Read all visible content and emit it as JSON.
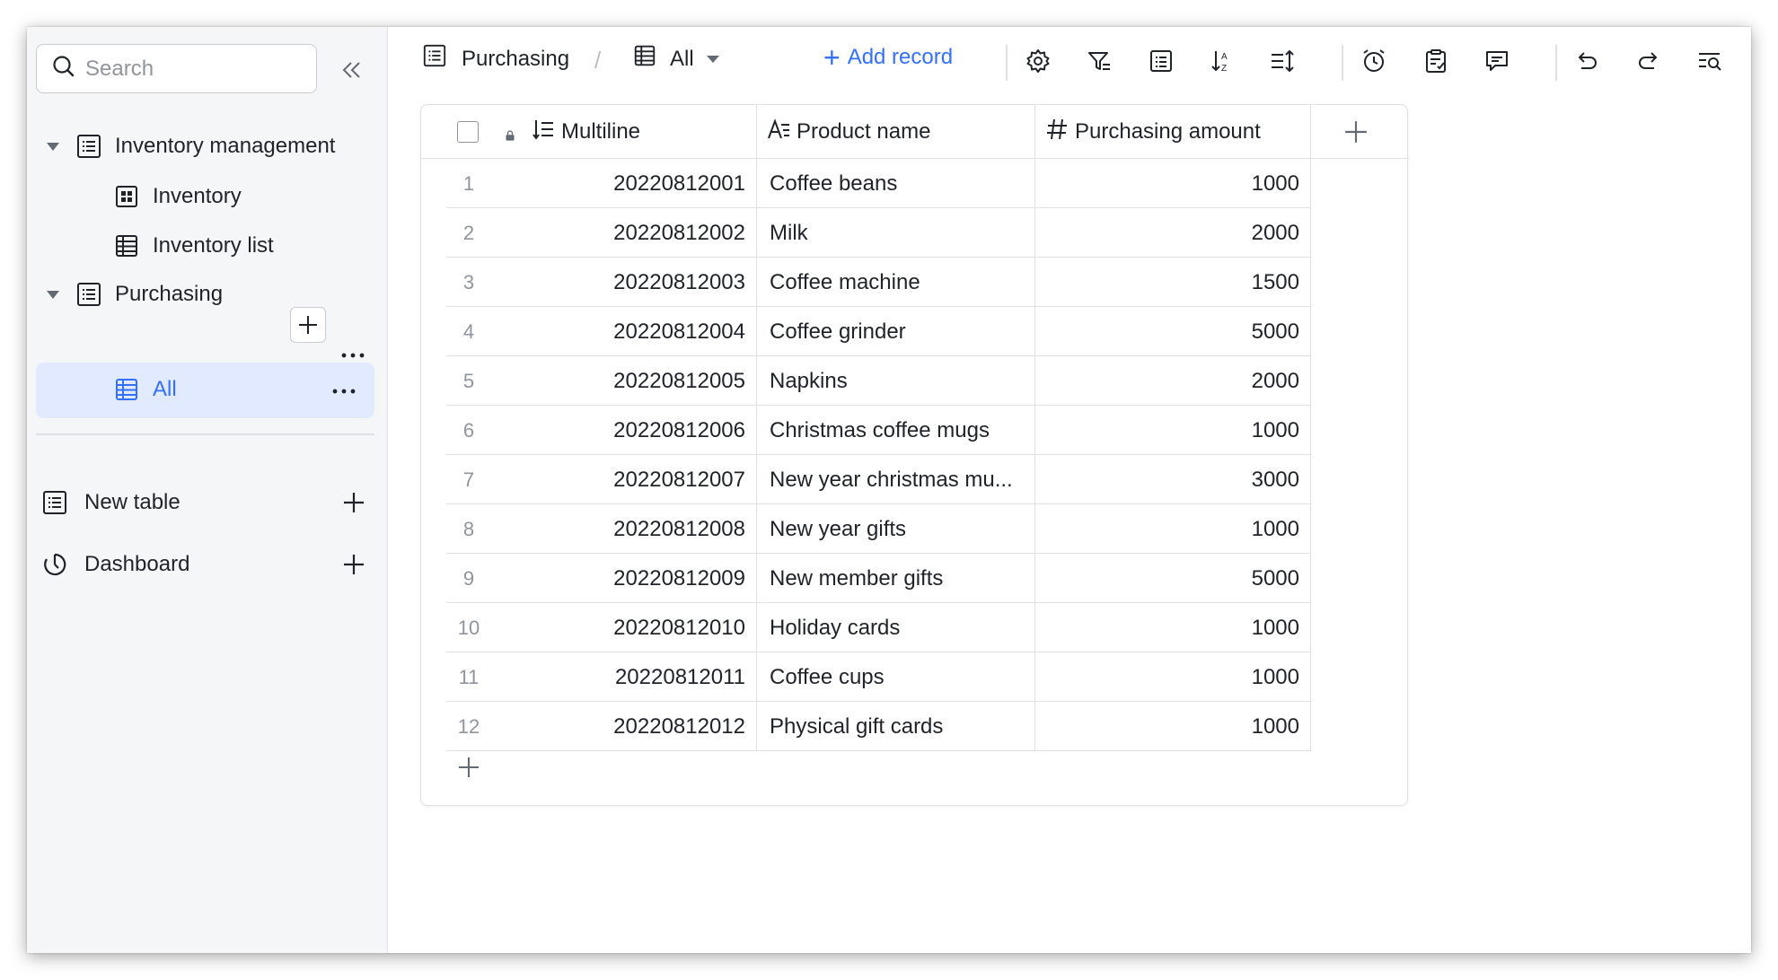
{
  "sidebar": {
    "search_placeholder": "Search",
    "tree": [
      {
        "label": "Inventory management",
        "icon": "table-doc-icon"
      },
      {
        "label": "Inventory",
        "icon": "grid-view-icon"
      },
      {
        "label": "Inventory list",
        "icon": "table-view-icon"
      },
      {
        "label": "Purchasing",
        "icon": "table-doc-icon"
      },
      {
        "label": "All",
        "icon": "table-view-icon"
      }
    ],
    "new_table_label": "New table",
    "dashboard_label": "Dashboard"
  },
  "header": {
    "table_name": "Purchasing",
    "separator": "/",
    "view_name": "All",
    "add_record_label": "Add record",
    "add_record_plus": "+"
  },
  "columns": [
    {
      "label": "Multiline",
      "icon": "multiline-icon"
    },
    {
      "label": "Product name",
      "icon": "text-field-icon"
    },
    {
      "label": "Purchasing amount",
      "icon": "number-field-icon"
    }
  ],
  "rows": [
    {
      "idx": "1",
      "multiline": "20220812001",
      "product": "Coffee beans",
      "amount": "1000"
    },
    {
      "idx": "2",
      "multiline": "20220812002",
      "product": "Milk",
      "amount": "2000"
    },
    {
      "idx": "3",
      "multiline": "20220812003",
      "product": "Coffee machine",
      "amount": "1500"
    },
    {
      "idx": "4",
      "multiline": "20220812004",
      "product": "Coffee grinder",
      "amount": "5000"
    },
    {
      "idx": "5",
      "multiline": "20220812005",
      "product": "Napkins",
      "amount": "2000"
    },
    {
      "idx": "6",
      "multiline": "20220812006",
      "product": "Christmas coffee mugs",
      "amount": "1000"
    },
    {
      "idx": "7",
      "multiline": "20220812007",
      "product": "New year christmas mu...",
      "amount": "3000"
    },
    {
      "idx": "8",
      "multiline": "20220812008",
      "product": "New year gifts",
      "amount": "1000"
    },
    {
      "idx": "9",
      "multiline": "20220812009",
      "product": "New member gifts",
      "amount": "5000"
    },
    {
      "idx": "10",
      "multiline": "20220812010",
      "product": "Holiday cards",
      "amount": "1000"
    },
    {
      "idx": "11",
      "multiline": "20220812011",
      "product": "Coffee cups",
      "amount": "1000"
    },
    {
      "idx": "12",
      "multiline": "20220812012",
      "product": "Physical gift cards",
      "amount": "1000"
    }
  ],
  "colors": {
    "accent": "#3370ff",
    "active_bg": "#e1eaff",
    "border": "#dee0e3",
    "text": "#1f2329",
    "muted": "#8f959e"
  }
}
